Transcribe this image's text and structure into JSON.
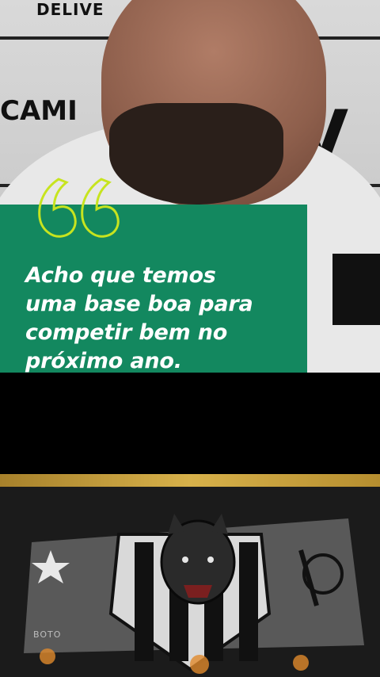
{
  "backdrop": {
    "word_top": "DELIVE",
    "word_mid": "CAMI",
    "word_big": "V",
    "side_badge": "BOTO"
  },
  "quote": {
    "line1": "Acho que temos",
    "line2": "uma base boa para",
    "line3": "competir bem no",
    "line4": "próximo ano."
  },
  "colors": {
    "card": "#13885f",
    "quote_marks": "#c7e41f",
    "gold": "#d7b14a"
  },
  "icons": {
    "quote": "quote-open-icon",
    "crest": "crest-icon",
    "star": "star-icon"
  }
}
